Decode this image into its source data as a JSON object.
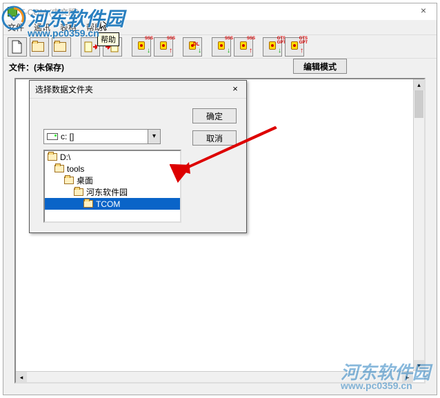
{
  "app": {
    "title": "T-COM (中文版)",
    "menu": {
      "file": "文件",
      "comm": "通讯",
      "table": "表格",
      "help": "帮助"
    },
    "tooltip": "帮助"
  },
  "toolbar": {
    "items": [
      "new",
      "open",
      "save",
      "export",
      "import",
      "inst-sss-dn",
      "inst-sss-up",
      "inst-dl",
      "inst-sss-dn2",
      "inst-sss-up2",
      "inst-gts-dn",
      "inst-gts-up"
    ]
  },
  "filebar": {
    "label": "文件：",
    "status": "(未保存)",
    "editmode": "编辑模式"
  },
  "dialog": {
    "title": "选择数据文件夹",
    "ok": "确定",
    "cancel": "取消",
    "drive": "c: []",
    "tree": [
      {
        "label": "D:\\",
        "indent": 0,
        "open": true
      },
      {
        "label": "tools",
        "indent": 1,
        "open": true
      },
      {
        "label": "桌面",
        "indent": 2,
        "open": true
      },
      {
        "label": "河东软件园",
        "indent": 3,
        "open": true
      },
      {
        "label": "TCOM",
        "indent": 4,
        "open": true,
        "selected": true
      }
    ]
  },
  "watermark": {
    "text": "河东软件园",
    "url": "www.pc0359.cn"
  }
}
